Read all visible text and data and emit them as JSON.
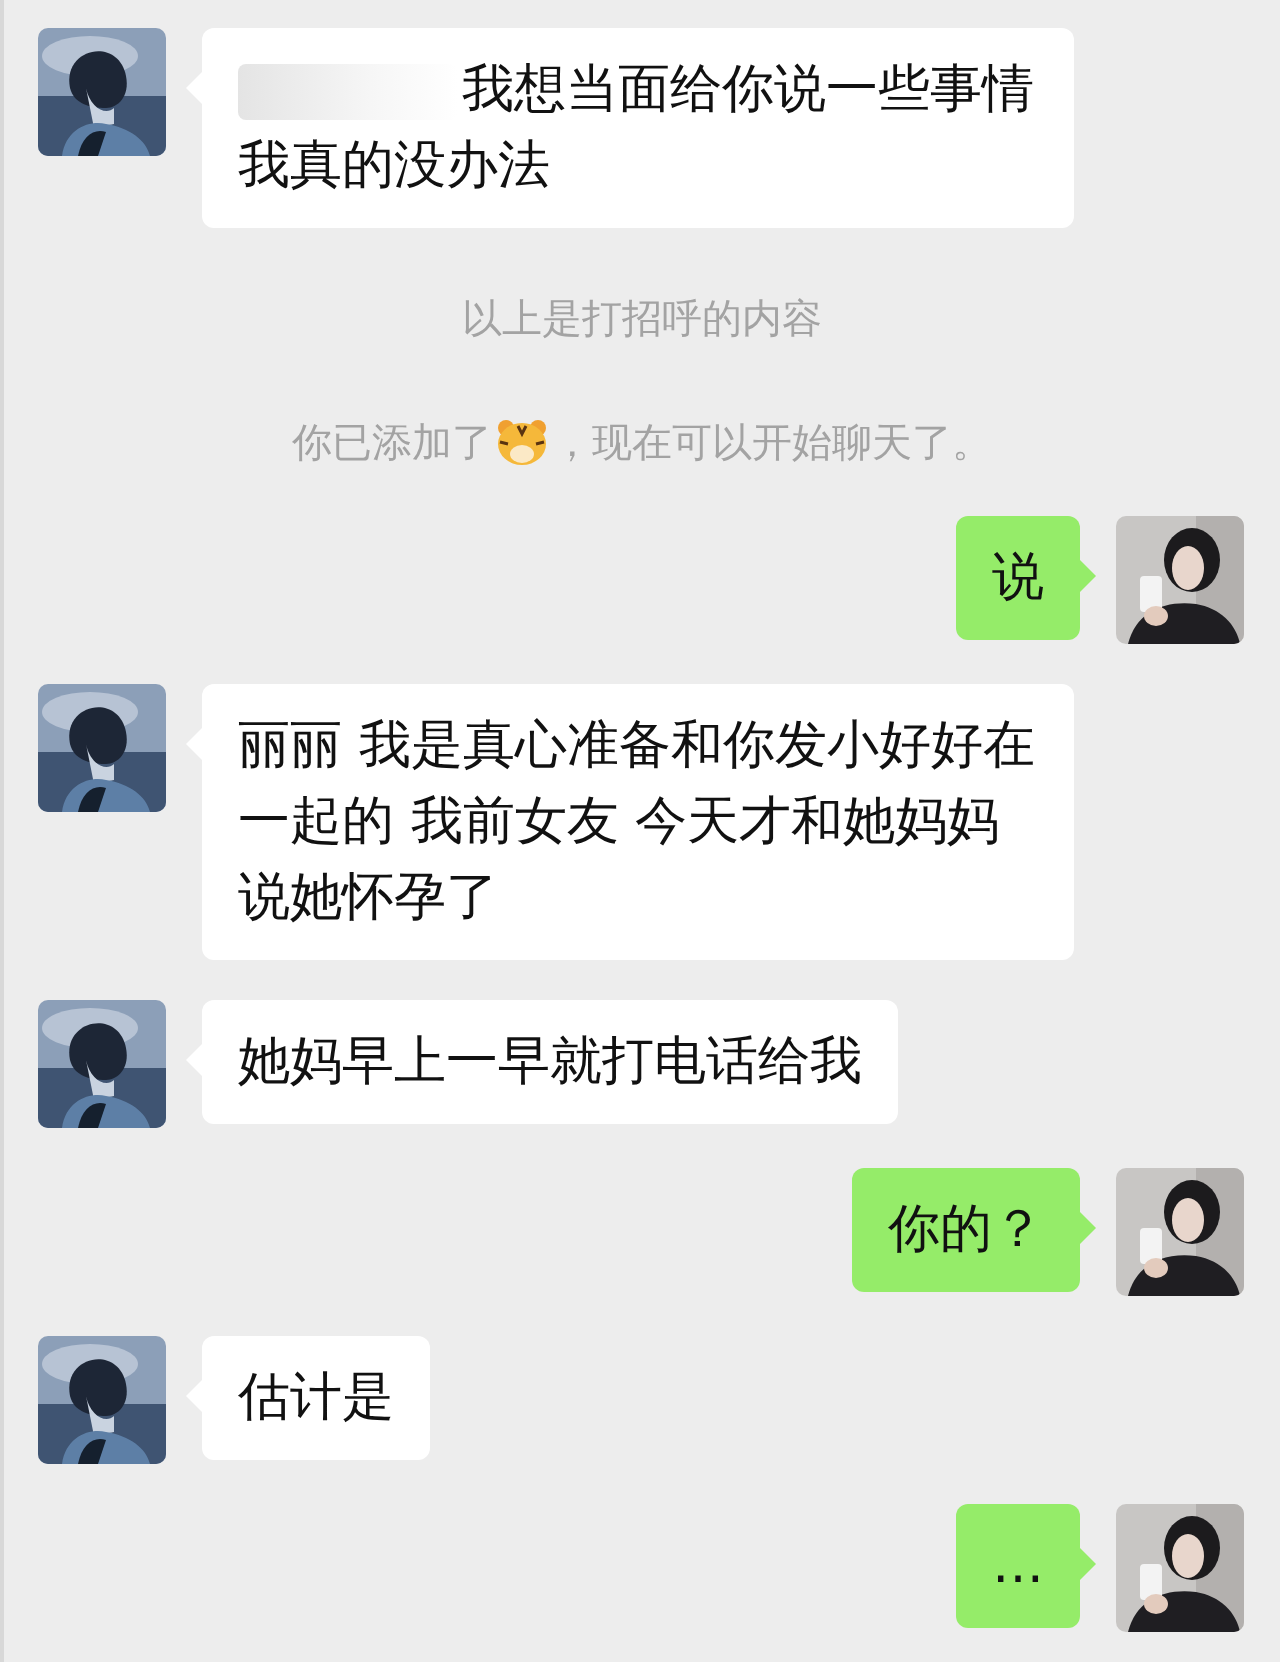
{
  "messages": [
    {
      "kind": "received",
      "text": "我想当面给你说一些事情我真的没办法",
      "redacted": true
    },
    {
      "kind": "note",
      "text": "以上是打招呼的内容"
    },
    {
      "kind": "note",
      "text": "你已添加了",
      "text_after": "，现在可以开始聊天了。",
      "emoji": true
    },
    {
      "kind": "sent",
      "text": "说"
    },
    {
      "kind": "received",
      "text": "丽丽 我是真心准备和你发小好好在一起的 我前女友 今天才和她妈妈说她怀孕了"
    },
    {
      "kind": "received",
      "text": "她妈早上一早就打电话给我"
    },
    {
      "kind": "sent",
      "text": "你的？"
    },
    {
      "kind": "received",
      "text": "估计是"
    },
    {
      "kind": "sent",
      "text": "…"
    }
  ]
}
